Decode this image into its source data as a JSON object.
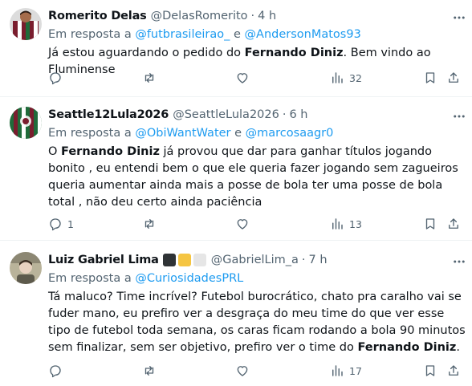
{
  "tweets": [
    {
      "name": "Romerito Delas",
      "handle": "@DelasRomerito",
      "separator": "·",
      "time": "4 h",
      "reply_prefix": "Em resposta a",
      "reply_to_1": "@futbrasileirao_",
      "reply_conj": "e",
      "reply_to_2": "@AndersonMatos93",
      "text_parts": [
        "Já estou aguardando o pedido do ",
        "Fernando Diniz",
        ". Bem vindo ao Fluminense"
      ],
      "replies": "",
      "retweets": "",
      "likes": "",
      "views": "32",
      "avatar_colors": [
        "#7a1d2e",
        "#1f6b3a",
        "#ffffff"
      ]
    },
    {
      "name": "Seattle12Lula2026",
      "handle": "@SeattleLula2026",
      "separator": "·",
      "time": "6 h",
      "reply_prefix": "Em resposta a",
      "reply_to_1": "@ObiWantWater",
      "reply_conj": "e",
      "reply_to_2": "@marcosaagr0",
      "text_parts": [
        "O ",
        "Fernando Diniz",
        " já provou que dar para ganhar títulos jogando bonito , eu entendi bem o que ele queria fazer jogando sem zagueiros queria aumentar ainda mais a posse de bola ter uma posse de bola total , não deu certo ainda paciência"
      ],
      "replies": "1",
      "retweets": "",
      "likes": "",
      "views": "13",
      "avatar_colors": [
        "#7a1d2e",
        "#1f6b3a",
        "#d9d9d9"
      ]
    },
    {
      "name": "Luiz Gabriel Lima",
      "handle": "@GabrielLim_a",
      "separator": "·",
      "time": "7 h",
      "badge_colors": [
        "#2f3336",
        "#f5c542",
        "#e6e6e6"
      ],
      "reply_prefix": "Em resposta a",
      "reply_to_1": "@CuriosidadesPRL",
      "text_parts": [
        "Tá maluco? Time incrível? Futebol burocrático, chato pra caralho vai se fuder mano, eu prefiro ver a desgraça do meu time do que ver esse tipo de futebol toda semana, os caras ficam rodando a bola 90 minutos sem finalizar, sem ser objetivo, prefiro ver o time do ",
        "Fernando Diniz",
        "."
      ],
      "replies": "",
      "retweets": "",
      "likes": "",
      "views": "17",
      "avatar_colors": [
        "#b9b39a",
        "#5d5a4c",
        "#e8d2c0"
      ]
    }
  ],
  "icons": {
    "reply": "reply-icon",
    "retweet": "retweet-icon",
    "like": "heart-icon",
    "views": "views-icon",
    "bookmark": "bookmark-icon",
    "share": "share-icon",
    "more": "more-icon"
  },
  "colors": {
    "link": "#1d9bf0",
    "secondary": "#536471",
    "text": "#0f1419",
    "divider": "#eff3f4"
  }
}
